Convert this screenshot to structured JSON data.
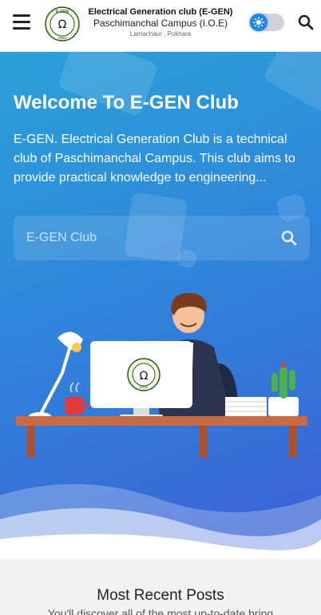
{
  "header": {
    "menu_icon": "hamburger-menu-icon",
    "logo": {
      "ring_text": "E-GEN",
      "year": "2069",
      "symbol": "Ω"
    },
    "title_line1": "Electrical Generation club (E-GEN)",
    "title_line2": "Paschimanchal Campus (I.O.E)",
    "title_line3": "Lamachaur , Pokhara",
    "theme_toggle_icon": "sun-icon",
    "search_icon": "search-icon"
  },
  "hero": {
    "heading": "Welcome To E-GEN Club",
    "description": "E-GEN. Electrical Generation Club is a technical club of Paschimanchal Campus. This club aims to provide practical knowledge to engineering...",
    "search": {
      "placeholder": "E-GEN Club",
      "icon": "search-icon"
    },
    "illustration": {
      "monitor_logo_year": "2069",
      "monitor_logo_symbol": "Ω"
    }
  },
  "section": {
    "title": "Most Recent Posts",
    "subtitle": "You'll discover all of the most up-to-date bring"
  },
  "colors": {
    "hero_top": "#2aa1d8",
    "hero_bottom": "#3c5fd6",
    "toggle_knob": "#1d87e6"
  }
}
